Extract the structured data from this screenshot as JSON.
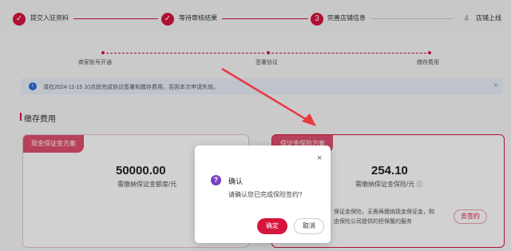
{
  "steps": [
    {
      "num": "✓",
      "label": "提交入驻资料"
    },
    {
      "num": "✓",
      "label": "等待审核结果"
    },
    {
      "num": "3",
      "label": "完善店铺信息"
    },
    {
      "num": "4",
      "label": "店铺上线"
    }
  ],
  "substeps": [
    "商家账号开通",
    "签署协议",
    "缴存费用"
  ],
  "notice": {
    "icon": "info-icon",
    "text": "请在2024-11-15 10点前完成协议签署和缴存费用，否则本次申请失效。",
    "close": "×"
  },
  "section_title": "缴存费用",
  "cards": [
    {
      "tag": "现金保证金方案",
      "amount": "50000.00",
      "sub": "需缴纳保证金额度/元"
    },
    {
      "tag": "保证金保险方案",
      "amount": "254.10",
      "sub": "需缴纳保证金保险/元 ⓘ"
    }
  ],
  "side_texts": [
    "保证金保险，无需再缴纳现金保证金，购",
    "由保险公司提供的担保履约服务"
  ],
  "sign_button": "去签约",
  "dialog": {
    "icon": "?",
    "title": "确认",
    "text": "请确认您已完成保险签约?",
    "ok": "确定",
    "cancel": "取消",
    "close": "×"
  },
  "colors": {
    "accent": "#d6153d",
    "dialog_icon": "#7a3fc4"
  }
}
